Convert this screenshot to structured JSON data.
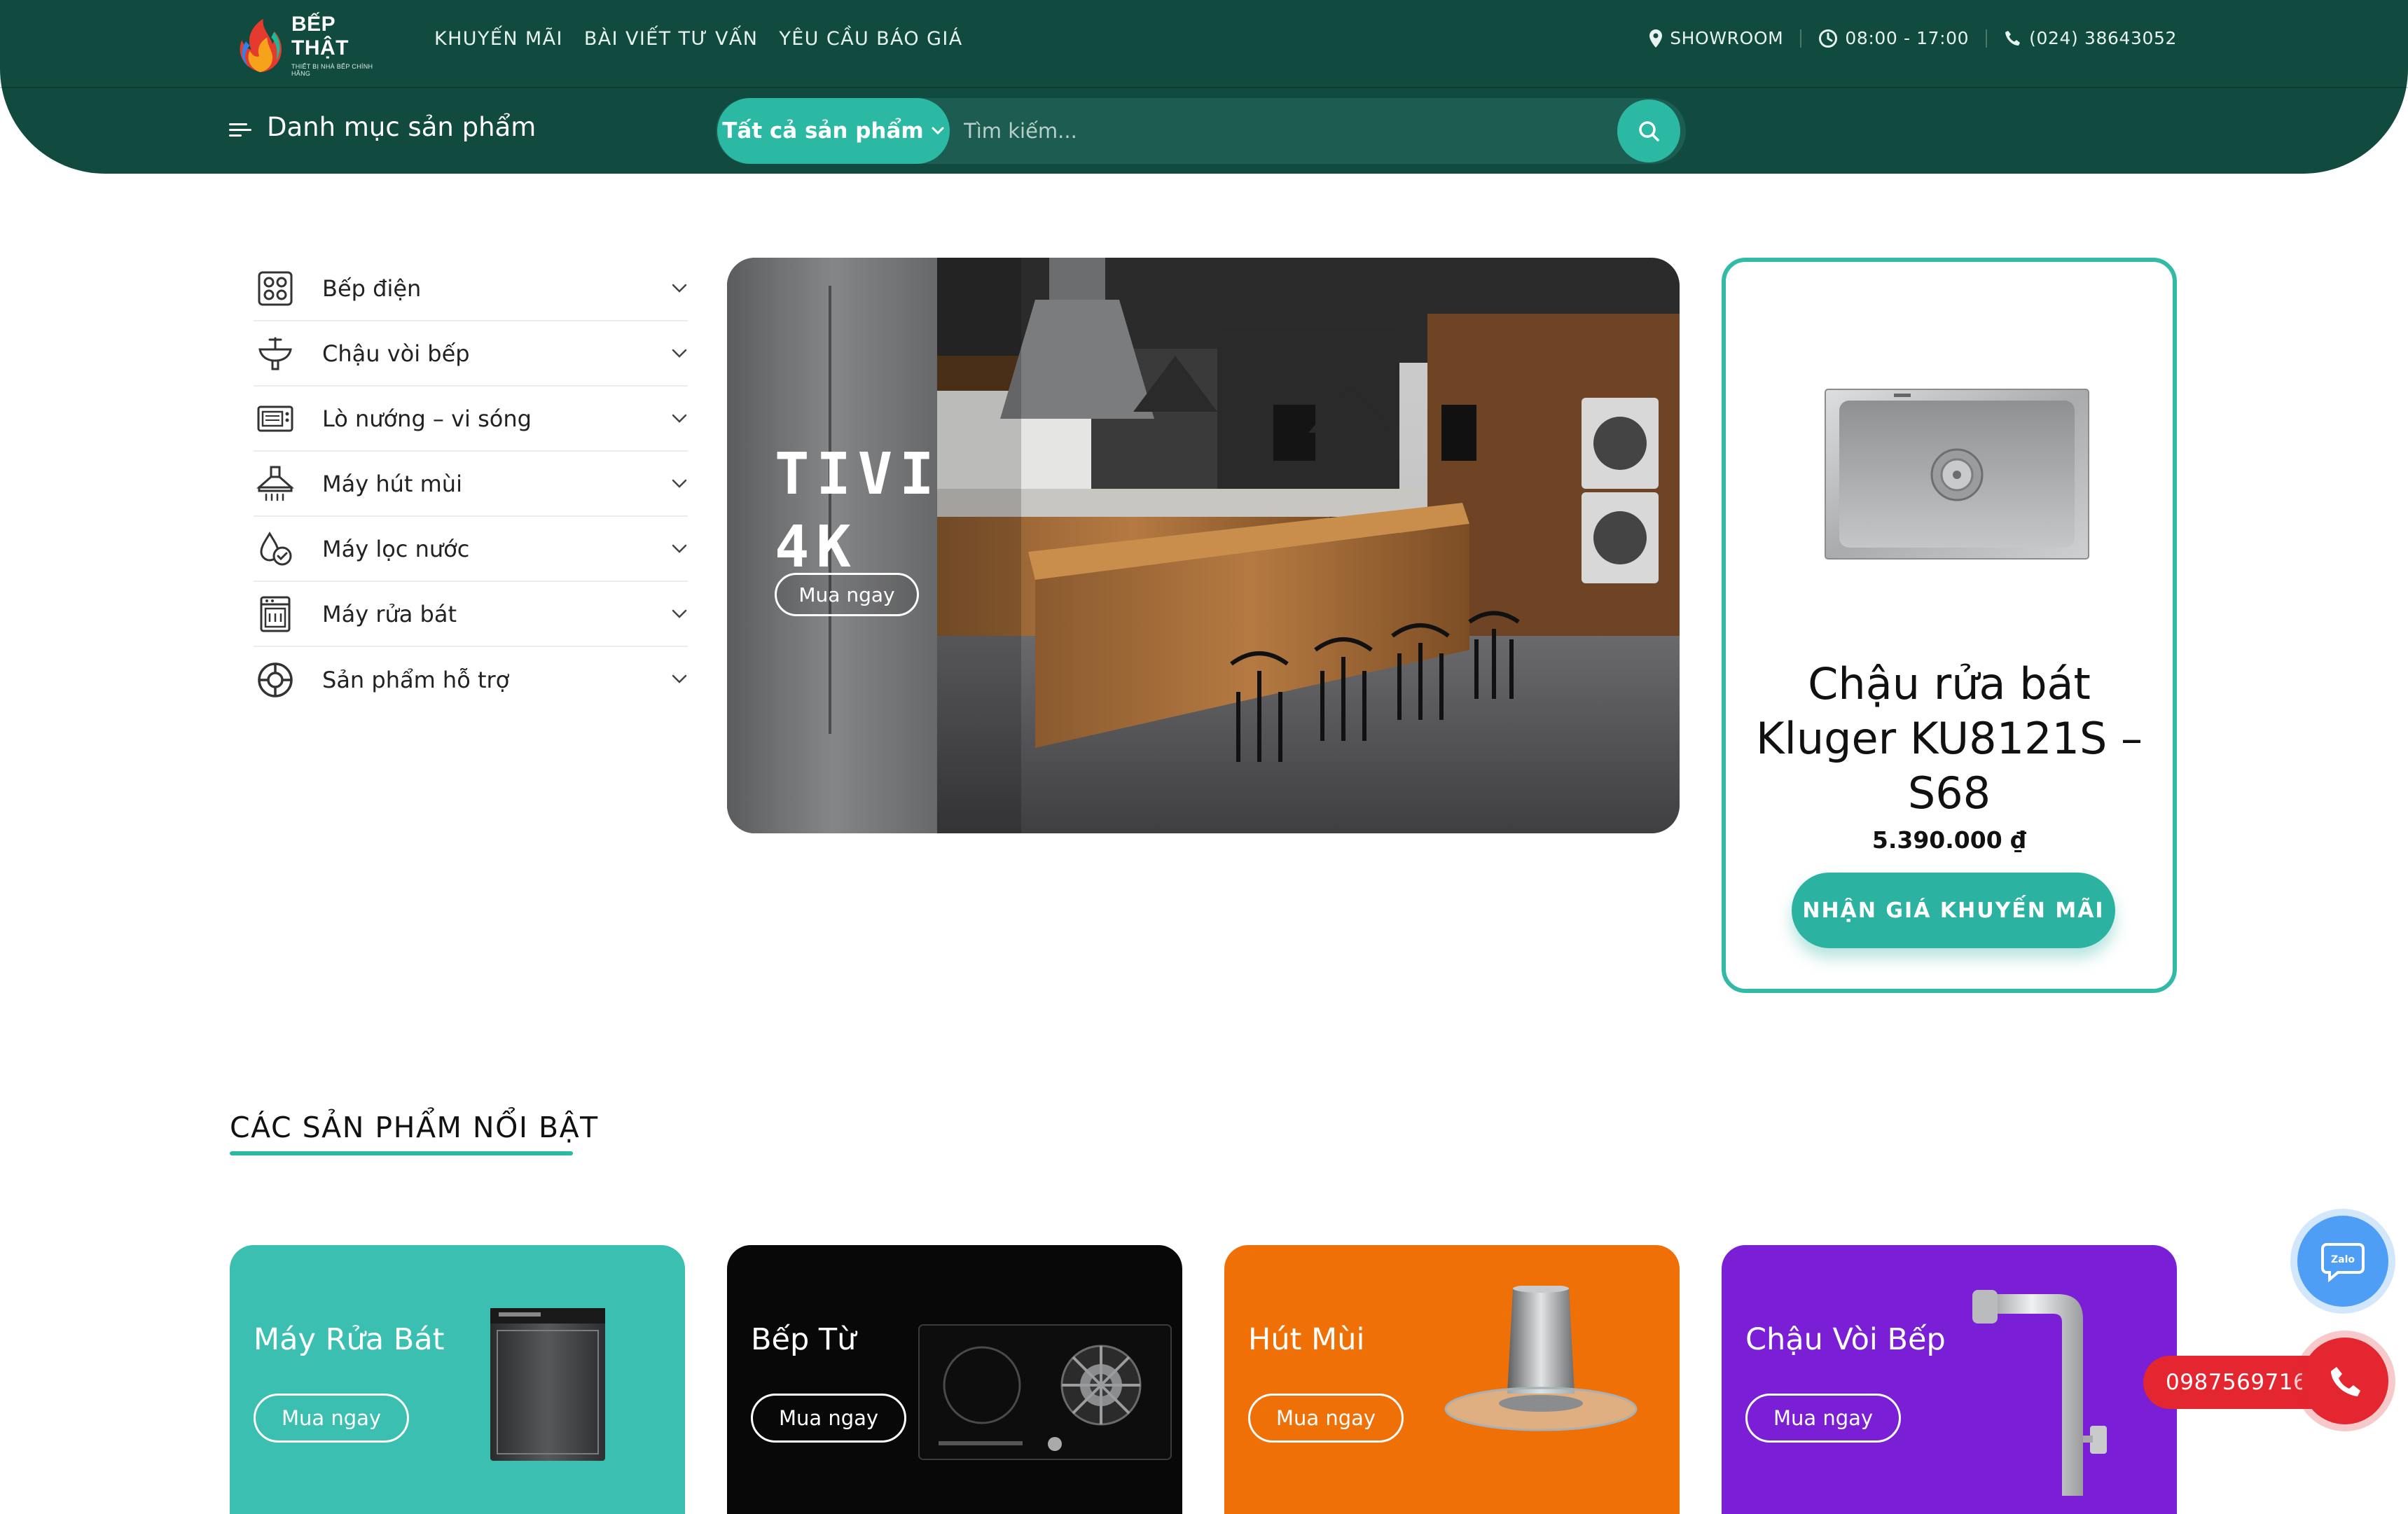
{
  "header": {
    "logo": {
      "name": "BẾP THẬT",
      "tagline": "THIẾT BỊ NHÀ BẾP CHÍNH HÃNG"
    },
    "nav": [
      "KHUYẾN MÃI",
      "BÀI VIẾT TƯ VẤN",
      "YÊU CẦU BÁO GIÁ"
    ],
    "info": {
      "showroom": "SHOWROOM",
      "hours": "08:00 - 17:00",
      "phone": "(024) 38643052"
    },
    "category_menu": "Danh mục sản phẩm",
    "search": {
      "scope": "Tất cả sản phẩm",
      "placeholder": "Tìm kiếm..."
    }
  },
  "sidebar": {
    "categories": [
      {
        "label": "Bếp điện",
        "icon": "cooktop-icon"
      },
      {
        "label": "Chậu vòi bếp",
        "icon": "sink-faucet-icon"
      },
      {
        "label": "Lò nướng – vi sóng",
        "icon": "microwave-icon"
      },
      {
        "label": "Máy hút mùi",
        "icon": "range-hood-icon"
      },
      {
        "label": "Máy lọc nước",
        "icon": "water-purifier-icon"
      },
      {
        "label": "Máy rửa bát",
        "icon": "dishwasher-icon"
      },
      {
        "label": "Sản phẩm hỗ trợ",
        "icon": "support-lifebuoy-icon"
      }
    ]
  },
  "hero": {
    "title": "TIVI\n4K",
    "button": "Mua ngay"
  },
  "promo": {
    "title": "Chậu rửa bát Kluger KU8121S – S68",
    "price": "5.390.000 ₫",
    "button": "NHẬN GIÁ KHUYẾN MÃI"
  },
  "featured": {
    "heading": "CÁC SẢN PHẨM NỔI BẬT",
    "cards": [
      {
        "name": "Máy Rửa Bát",
        "button": "Mua ngay",
        "color": "#3bbfb0"
      },
      {
        "name": "Bếp Từ",
        "button": "Mua ngay",
        "color": "#080808"
      },
      {
        "name": "Hút Mùi",
        "button": "Mua ngay",
        "color": "#f07008"
      },
      {
        "name": "Chậu Vòi Bếp",
        "button": "Mua ngay",
        "color": "#7a1fd6"
      }
    ]
  },
  "floating": {
    "zalo": "Zalo",
    "phone": "0987569716"
  },
  "colors": {
    "header": "#114a3f",
    "accent": "#2bb9a4",
    "phone": "#e3262f",
    "zalo": "#4f9ef5"
  }
}
